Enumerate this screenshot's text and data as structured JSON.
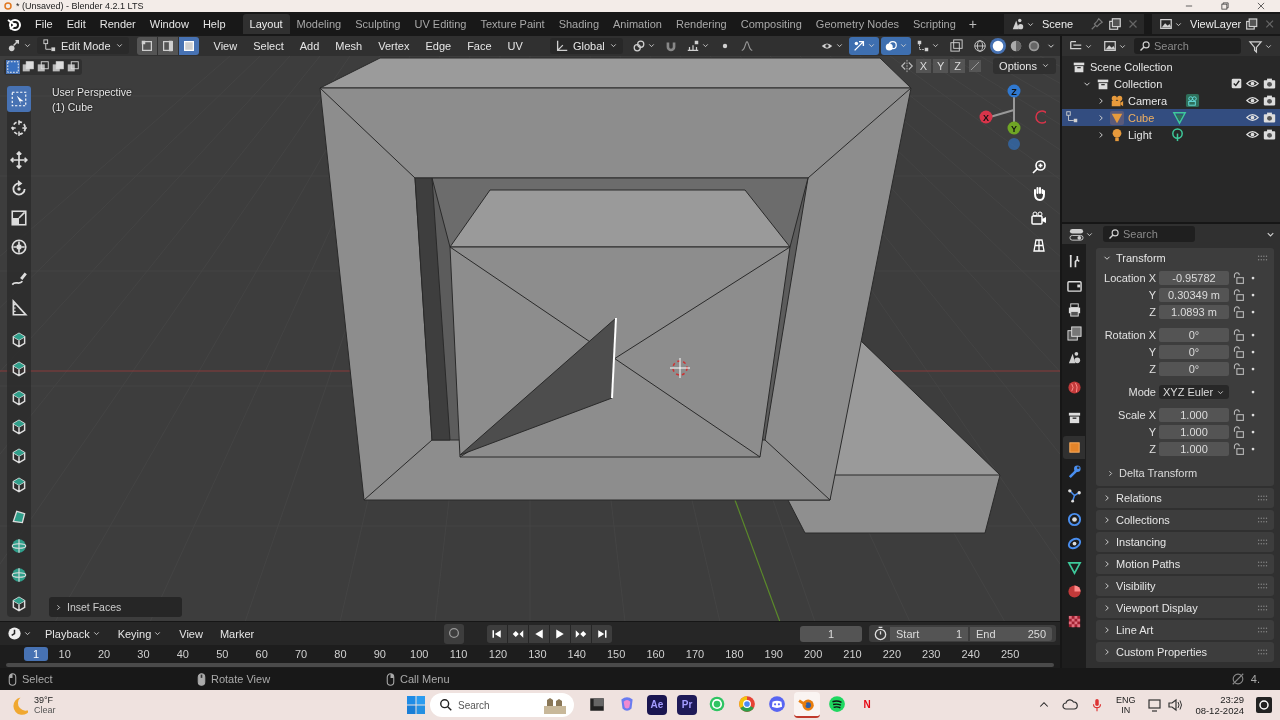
{
  "window": {
    "title": "* (Unsaved) - Blender 4.2.1 LTS"
  },
  "menu": [
    "File",
    "Edit",
    "Render",
    "Window",
    "Help"
  ],
  "workspaces": [
    {
      "label": "Layout",
      "selected": true
    },
    {
      "label": "Modeling",
      "selected": false
    },
    {
      "label": "Sculpting",
      "selected": false
    },
    {
      "label": "UV Editing",
      "selected": false
    },
    {
      "label": "Texture Paint",
      "selected": false
    },
    {
      "label": "Shading",
      "selected": false
    },
    {
      "label": "Animation",
      "selected": false
    },
    {
      "label": "Rendering",
      "selected": false
    },
    {
      "label": "Compositing",
      "selected": false
    },
    {
      "label": "Geometry Nodes",
      "selected": false
    },
    {
      "label": "Scripting",
      "selected": false
    }
  ],
  "new_workspace": "+",
  "scene": "Scene",
  "view_layer": "ViewLayer",
  "viewport": {
    "mode": "Edit Mode",
    "select_modes": [
      {
        "kind": "vertex",
        "selected": false
      },
      {
        "kind": "edge",
        "selected": false
      },
      {
        "kind": "face",
        "selected": true
      }
    ],
    "menus": [
      "View",
      "Select",
      "Add",
      "Mesh",
      "Vertex",
      "Edge",
      "Face",
      "UV"
    ],
    "orientation": "Global",
    "shading": [
      {
        "kind": "wireframe",
        "selected": false
      },
      {
        "kind": "solid",
        "selected": true
      },
      {
        "kind": "material",
        "selected": false
      },
      {
        "kind": "rendered",
        "selected": false
      }
    ],
    "axis_toggles": [
      "X",
      "Y",
      "Z"
    ],
    "options": "Options",
    "view_name": "User Perspective",
    "object_name": "(1) Cube",
    "gizmo": [
      {
        "label": "Z",
        "color": "#2f78d0"
      },
      {
        "label": "Y",
        "color": "#6fa624"
      },
      {
        "label": "X",
        "color": "#d8344a"
      }
    ],
    "tools": [
      {
        "kind": "select",
        "selected": true
      },
      {
        "kind": "cursor",
        "selected": false
      },
      {
        "kind": "move",
        "selected": false
      },
      {
        "kind": "rotate",
        "selected": false
      },
      {
        "kind": "scale",
        "selected": false
      },
      {
        "kind": "transform",
        "selected": false
      },
      {
        "kind": "annotate",
        "selected": false
      },
      {
        "kind": "measure",
        "selected": false
      },
      {
        "kind": "cube",
        "selected": false
      },
      {
        "kind": "cube",
        "selected": false
      },
      {
        "kind": "cube",
        "selected": false
      },
      {
        "kind": "cube",
        "selected": false
      },
      {
        "kind": "cube",
        "selected": false
      },
      {
        "kind": "cube",
        "selected": false
      },
      {
        "kind": "polygon",
        "selected": false
      },
      {
        "kind": "sphere",
        "selected": false
      },
      {
        "kind": "sphere",
        "selected": false
      },
      {
        "kind": "cube",
        "selected": false
      }
    ],
    "last_operator": "Inset Faces"
  },
  "outliner": {
    "search": {
      "placeholder": "Search"
    },
    "tree": [
      {
        "label": "Scene Collection",
        "kind": "scene_collection",
        "selected": false,
        "children": [
          {
            "label": "Collection",
            "kind": "collection",
            "selected": false,
            "expanded": true,
            "checked": true,
            "children": [
              {
                "label": "Camera",
                "kind": "camera",
                "selected": false,
                "expanded": false
              },
              {
                "label": "Cube",
                "kind": "mesh",
                "selected": true,
                "expanded": false
              },
              {
                "label": "Light",
                "kind": "light",
                "selected": false,
                "expanded": false
              }
            ]
          }
        ]
      }
    ]
  },
  "properties": {
    "search": {
      "placeholder": "Search"
    },
    "tabs": [
      {
        "kind": "tool",
        "selected": false
      },
      {
        "kind": "render",
        "selected": false
      },
      {
        "kind": "output",
        "selected": false
      },
      {
        "kind": "view_layer",
        "selected": false
      },
      {
        "kind": "scene",
        "selected": false
      },
      {
        "kind": "world",
        "selected": false
      },
      {
        "kind": "collection",
        "selected": false
      },
      {
        "kind": "object",
        "selected": true
      },
      {
        "kind": "modifier",
        "selected": false
      },
      {
        "kind": "particles",
        "selected": false
      },
      {
        "kind": "physics",
        "selected": false
      },
      {
        "kind": "constraints",
        "selected": false
      },
      {
        "kind": "data",
        "selected": false
      },
      {
        "kind": "material",
        "selected": false
      },
      {
        "kind": "texture",
        "selected": false
      }
    ],
    "panel": {
      "title": "Transform",
      "expanded": true,
      "groups": [
        [
          {
            "label": "Location X",
            "value": "-0.95782",
            "kind": "number"
          },
          {
            "label": "Y",
            "value": "0.30349 m",
            "kind": "number"
          },
          {
            "label": "Z",
            "value": "1.0893 m",
            "kind": "number"
          }
        ],
        [
          {
            "label": "Rotation X",
            "value": "0°",
            "kind": "number"
          },
          {
            "label": "Y",
            "value": "0°",
            "kind": "number"
          },
          {
            "label": "Z",
            "value": "0°",
            "kind": "number"
          }
        ],
        [
          {
            "label": "Mode",
            "value": "XYZ Euler",
            "kind": "dropdown"
          }
        ],
        [
          {
            "label": "Scale X",
            "value": "1.000",
            "kind": "number"
          },
          {
            "label": "Y",
            "value": "1.000",
            "kind": "number"
          },
          {
            "label": "Z",
            "value": "1.000",
            "kind": "number"
          }
        ]
      ],
      "subpanel": "Delta Transform"
    },
    "collapsed_panels": [
      "Relations",
      "Collections",
      "Instancing",
      "Motion Paths",
      "Visibility",
      "Viewport Display",
      "Line Art",
      "Custom Properties"
    ]
  },
  "timeline": {
    "menus": [
      "Playback",
      "Keying",
      "View",
      "Marker"
    ],
    "current_frame": "1",
    "start_label": "Start",
    "start": "1",
    "end_label": "End",
    "end": "250",
    "ruler": [
      {
        "label": "1",
        "selected": true
      },
      {
        "label": "10",
        "selected": false
      },
      {
        "label": "20",
        "selected": false
      },
      {
        "label": "30",
        "selected": false
      },
      {
        "label": "40",
        "selected": false
      },
      {
        "label": "50",
        "selected": false
      },
      {
        "label": "60",
        "selected": false
      },
      {
        "label": "70",
        "selected": false
      },
      {
        "label": "80",
        "selected": false
      },
      {
        "label": "90",
        "selected": false
      },
      {
        "label": "100",
        "selected": false
      },
      {
        "label": "110",
        "selected": false
      },
      {
        "label": "120",
        "selected": false
      },
      {
        "label": "130",
        "selected": false
      },
      {
        "label": "140",
        "selected": false
      },
      {
        "label": "150",
        "selected": false
      },
      {
        "label": "160",
        "selected": false
      },
      {
        "label": "170",
        "selected": false
      },
      {
        "label": "180",
        "selected": false
      },
      {
        "label": "190",
        "selected": false
      },
      {
        "label": "200",
        "selected": false
      },
      {
        "label": "210",
        "selected": false
      },
      {
        "label": "220",
        "selected": false
      },
      {
        "label": "230",
        "selected": false
      },
      {
        "label": "240",
        "selected": false
      },
      {
        "label": "250",
        "selected": false
      }
    ]
  },
  "status_bar": {
    "hints": [
      "Select",
      "Rotate View",
      "Call Menu"
    ],
    "version": "4."
  },
  "taskbar": {
    "weather": {
      "temperature": "39°F",
      "condition": "Clear"
    },
    "search": {
      "placeholder": "Search"
    },
    "apps": [
      {
        "kind": "task_view",
        "active": false
      },
      {
        "kind": "copilot",
        "active": false
      },
      {
        "kind": "ae",
        "label": "Ae",
        "active": false
      },
      {
        "kind": "pr",
        "label": "Pr",
        "active": false
      },
      {
        "kind": "whatsapp",
        "active": false
      },
      {
        "kind": "chrome",
        "active": false
      },
      {
        "kind": "discord",
        "active": false
      },
      {
        "kind": "blender",
        "active": true
      },
      {
        "kind": "spotify",
        "active": false
      },
      {
        "kind": "netflix",
        "label": "N",
        "active": false
      }
    ],
    "language": "ENG",
    "region": "IN",
    "time": "23:29",
    "date": "08-12-2024"
  }
}
